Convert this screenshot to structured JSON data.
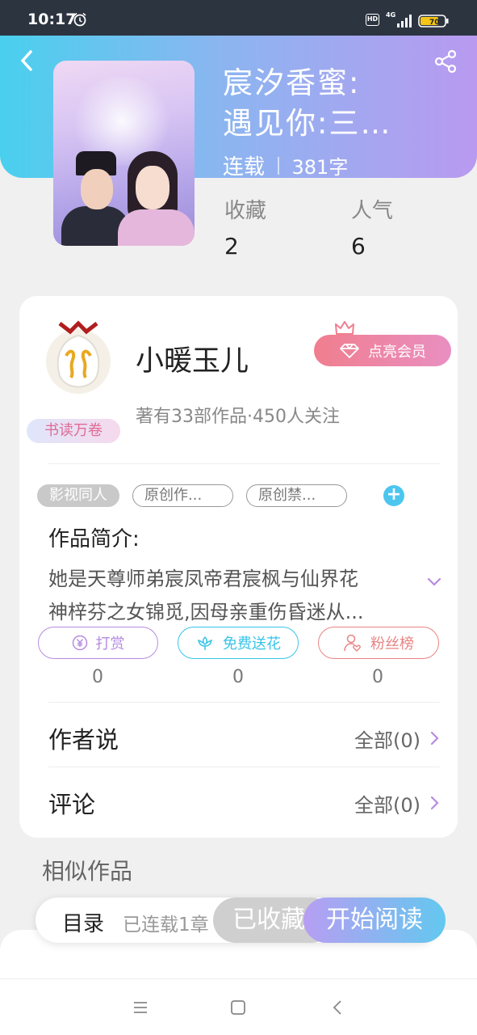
{
  "status_bar": {
    "time": "10:17",
    "network": "4G",
    "hd": "HD",
    "battery": "70"
  },
  "book": {
    "title_line1": "宸汐香蜜:",
    "title_line2": "遇见你:三…",
    "status": "连载",
    "word_count": "381字"
  },
  "stats": [
    {
      "label": "收藏",
      "value": "2"
    },
    {
      "label": "人气",
      "value": "6"
    }
  ],
  "author": {
    "name": "小暖玉儿",
    "badge": "书读万卷",
    "meta": "著有33部作品·450人关注",
    "vip_button": "点亮会员"
  },
  "tags": [
    "影视同人",
    "原创作...",
    "原创禁..."
  ],
  "intro": {
    "title": "作品简介:",
    "line1": "她是天尊师弟宸凤帝君宸枫与仙界花",
    "line2": "神梓芬之女锦觅,因母亲重伤昏迷从..."
  },
  "actions": [
    {
      "label": "打赏",
      "count": "0",
      "color": "#b68be0"
    },
    {
      "label": "免费送花",
      "count": "0",
      "color": "#38c4e8"
    },
    {
      "label": "粉丝榜",
      "count": "0",
      "color": "#e98383"
    }
  ],
  "rows": {
    "author_says": {
      "label": "作者说",
      "value": "全部(0)"
    },
    "comments": {
      "label": "评论",
      "value": "全部(0)"
    }
  },
  "similar_title": "相似作品",
  "bottom": {
    "toc": "目录",
    "toc_meta": "已连载1章",
    "collected": "已收藏",
    "read": "开始阅读"
  },
  "colors": {
    "header_start": "#49d0ee",
    "header_end": "#b99af0",
    "accent": "#4cc6ef",
    "purple": "#b68be0"
  }
}
